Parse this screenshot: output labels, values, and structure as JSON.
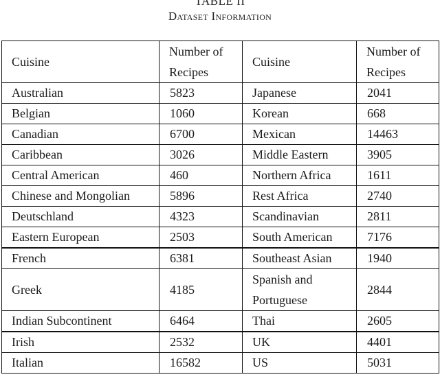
{
  "caption": {
    "label": "TABLE II",
    "title": "Dataset Information"
  },
  "table": {
    "headers": [
      "Cuisine",
      "Number of Recipes",
      "Cuisine",
      "Number of Recipes"
    ],
    "rows": [
      {
        "cuisine_left": "Australian",
        "count_left": "5823",
        "cuisine_right": "Japanese",
        "count_right": "2041"
      },
      {
        "cuisine_left": "Belgian",
        "count_left": "1060",
        "cuisine_right": "Korean",
        "count_right": "668"
      },
      {
        "cuisine_left": "Canadian",
        "count_left": "6700",
        "cuisine_right": "Mexican",
        "count_right": "14463"
      },
      {
        "cuisine_left": "Caribbean",
        "count_left": "3026",
        "cuisine_right": "Middle Eastern",
        "count_right": "3905"
      },
      {
        "cuisine_left": "Central American",
        "count_left": "460",
        "cuisine_right": "Northern Africa",
        "count_right": "1611"
      },
      {
        "cuisine_left": "Chinese and Mongolian",
        "count_left": "5896",
        "cuisine_right": "Rest Africa",
        "count_right": "2740"
      },
      {
        "cuisine_left": "Deutschland",
        "count_left": "4323",
        "cuisine_right": "Scandinavian",
        "count_right": "2811"
      },
      {
        "cuisine_left": "Eastern European",
        "count_left": "2503",
        "cuisine_right": "South American",
        "count_right": "7176"
      },
      {
        "cuisine_left": "French",
        "count_left": "6381",
        "cuisine_right": "Southeast Asian",
        "count_right": "1940"
      },
      {
        "cuisine_left": "Greek",
        "count_left": "4185",
        "cuisine_right": "Spanish and Portuguese",
        "count_right": "2844"
      },
      {
        "cuisine_left": "Indian Subcontinent",
        "count_left": "6464",
        "cuisine_right": "Thai",
        "count_right": "2605"
      },
      {
        "cuisine_left": "Irish",
        "count_left": "2532",
        "cuisine_right": "UK",
        "count_right": "4401"
      },
      {
        "cuisine_left": "Italian",
        "count_left": "16582",
        "cuisine_right": "US",
        "count_right": "5031"
      }
    ]
  }
}
